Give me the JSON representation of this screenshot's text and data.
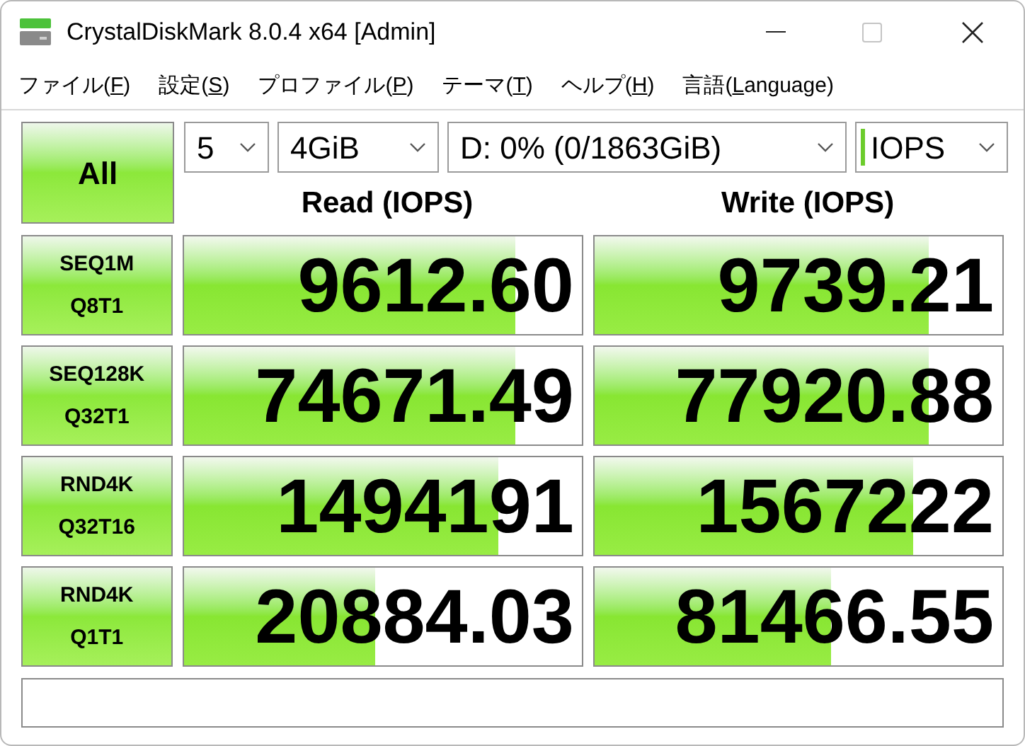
{
  "window": {
    "title": "CrystalDiskMark 8.0.4 x64 [Admin]"
  },
  "menu": [
    {
      "before": "ファイル(",
      "key": "F",
      "after": ")"
    },
    {
      "before": "設定(",
      "key": "S",
      "after": ")"
    },
    {
      "before": "プロファイル(",
      "key": "P",
      "after": ")"
    },
    {
      "before": "テーマ(",
      "key": "T",
      "after": ")"
    },
    {
      "before": "ヘルプ(",
      "key": "H",
      "after": ")"
    },
    {
      "before": "言語(",
      "key": "L",
      "after": "anguage)"
    }
  ],
  "all_button": "All",
  "selects": [
    {
      "kind": "plain",
      "value": "5"
    },
    {
      "kind": "plain",
      "value": "4GiB"
    },
    {
      "kind": "plain",
      "value": "D: 0% (0/1863GiB)"
    },
    {
      "kind": "unit",
      "value": "IOPS"
    }
  ],
  "columns": [
    "Read (IOPS)",
    "Write (IOPS)"
  ],
  "rows": [
    {
      "test": [
        "SEQ1M",
        "Q8T1"
      ],
      "read": {
        "value": "9612.60",
        "level": 0.83
      },
      "write": {
        "value": "9739.21",
        "level": 0.82
      }
    },
    {
      "test": [
        "SEQ128K",
        "Q32T1"
      ],
      "read": {
        "value": "74671.49",
        "level": 0.83
      },
      "write": {
        "value": "77920.88",
        "level": 0.82
      }
    },
    {
      "test": [
        "RND4K",
        "Q32T16"
      ],
      "read": {
        "value": "1494191",
        "level": 0.79
      },
      "write": {
        "value": "1567222",
        "level": 0.78
      }
    },
    {
      "test": [
        "RND4K",
        "Q1T1"
      ],
      "read": {
        "value": "20884.03",
        "level": 0.48
      },
      "write": {
        "value": "81466.55",
        "level": 0.58
      }
    }
  ]
}
